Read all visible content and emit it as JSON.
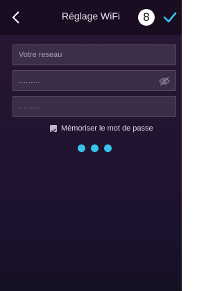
{
  "header": {
    "title": "Réglage WiFi",
    "step_number": "8"
  },
  "form": {
    "network_field": {
      "placeholder": "Votre reseau",
      "value": ""
    },
    "password_field": {
      "value": "........."
    },
    "confirm_password_field": {
      "value": "........."
    },
    "remember_password": {
      "label": "Mémoriser le mot de passe",
      "checked": true
    }
  },
  "icons": {
    "back": "chevron-left-icon",
    "confirm": "checkmark-icon",
    "visibility": "eye-slash-icon",
    "loading": "loading-dots"
  },
  "colors": {
    "accent": "#37c3ea",
    "background_top": "#2a1733",
    "background_bottom": "#151022"
  }
}
